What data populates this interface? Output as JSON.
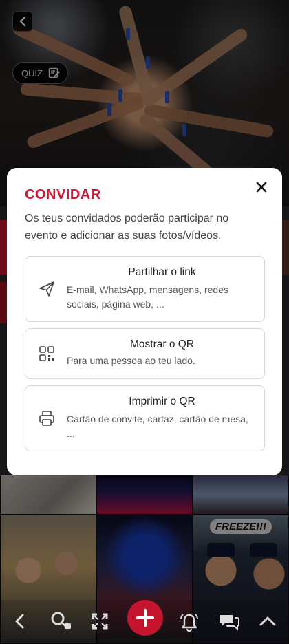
{
  "header": {
    "quiz_label": "QUIZ"
  },
  "modal": {
    "title": "CONVIDAR",
    "description": "Os teus convidados poderão participar no evento e adicionar as suas fotos/vídeos.",
    "options": [
      {
        "title": "Partilhar o link",
        "description": "E-mail, WhatsApp, mensagens, redes sociais, página web, ...",
        "icon": "send-icon"
      },
      {
        "title": "Mostrar o QR",
        "description": "Para uma pessoa ao teu lado.",
        "icon": "qr-code-icon"
      },
      {
        "title": "Imprimir o QR",
        "description": "Cartão de convite, cartaz, cartão de mesa, ...",
        "icon": "printer-icon"
      }
    ]
  },
  "gallery": {
    "tile_caption": "FREEZE!!!"
  },
  "colors": {
    "accent": "#d21633",
    "fab": "#c4142e"
  }
}
